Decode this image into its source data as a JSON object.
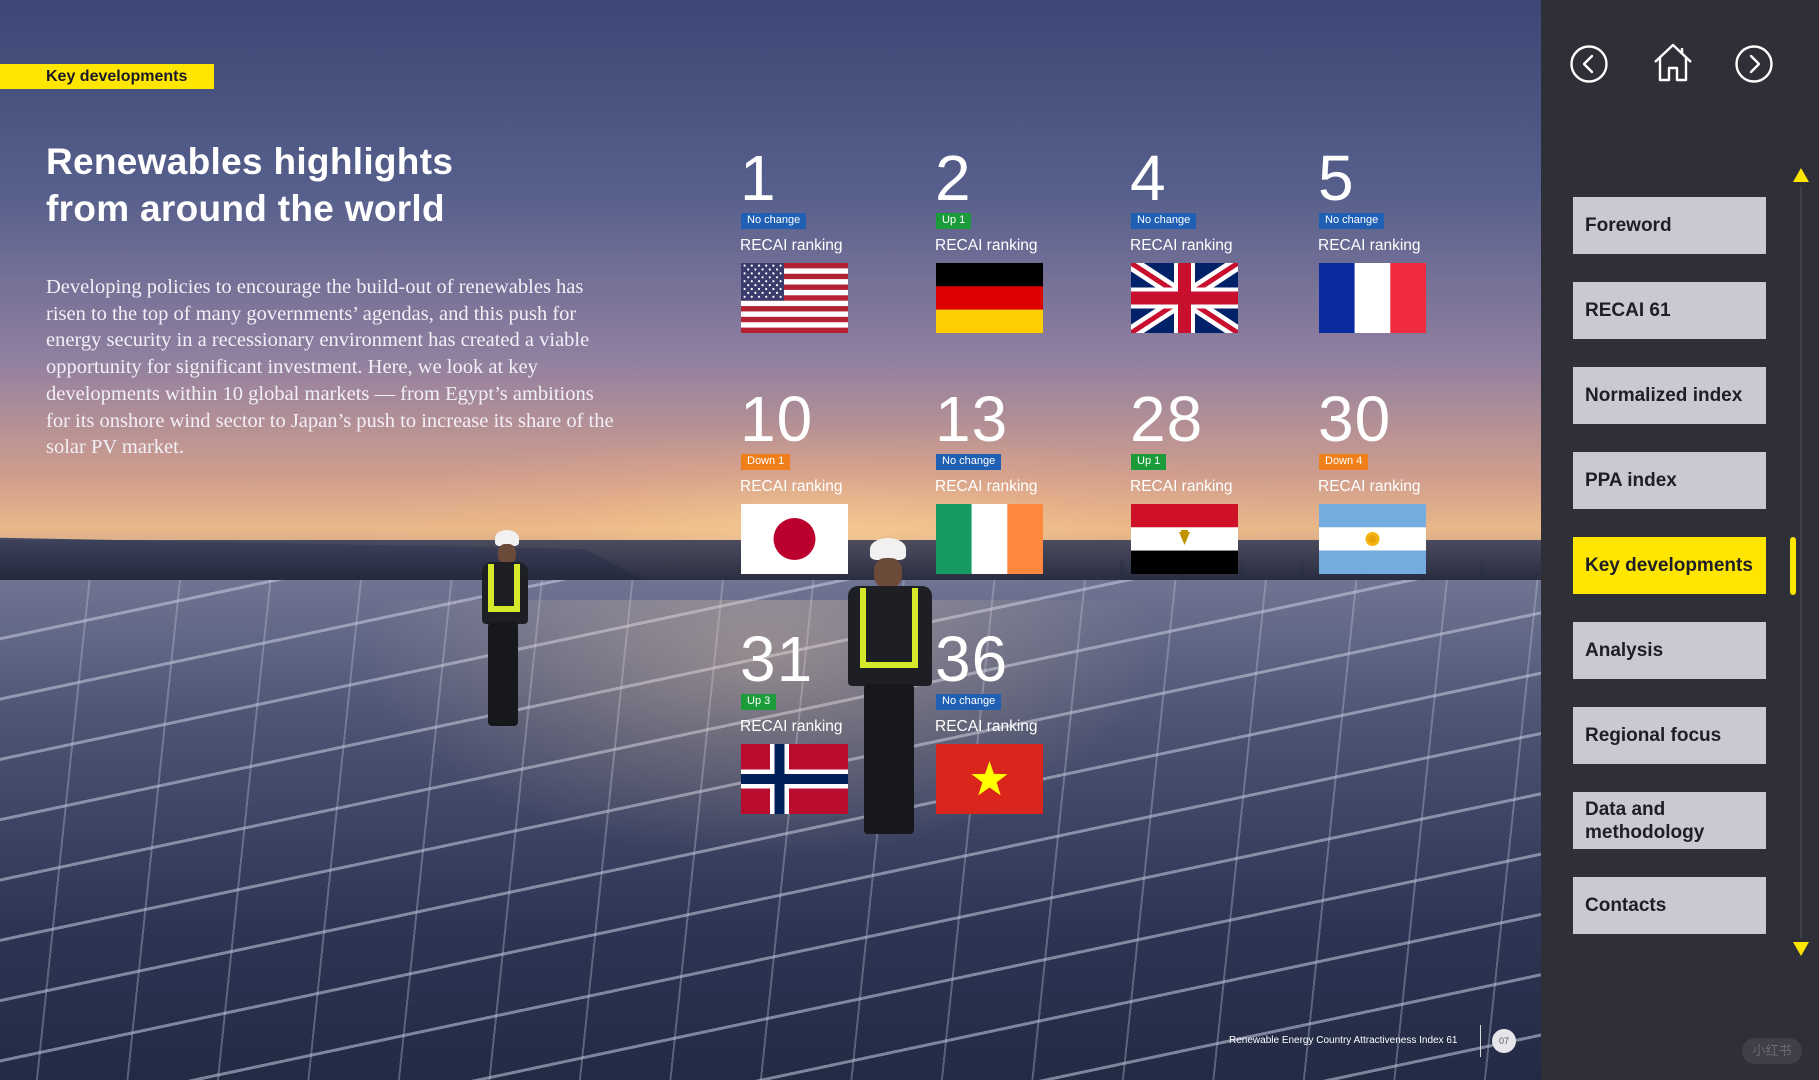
{
  "section_tag": "Key developments",
  "title": {
    "line1": "Renewables highlights",
    "line2": "from around the world"
  },
  "intro": "Developing policies to encourage the build-out of renewables has risen to the top of many governments’ agendas, and this push for energy security in a recessionary environment has created a viable opportunity for significant investment. Here, we look at key developments within 10 global markets — from Egypt’s ambitions for its onshore wind sector to Japan’s push to increase its share of the solar PV market.",
  "colors": {
    "accent_yellow": "#ffe600",
    "badge_no_change": "#1f5fb4",
    "badge_up": "#1c9b3a",
    "badge_down": "#ef7f1a",
    "nav_item_bg": "#c9c9d1",
    "nav_panel_bg": "#2f2f38"
  },
  "countries": [
    {
      "rank": "1",
      "change": "No change",
      "change_type": "no-change",
      "label": "RECAI ranking",
      "flag_icon": "usa-flag-icon"
    },
    {
      "rank": "2",
      "change": "Up 1",
      "change_type": "up",
      "label": "RECAI ranking",
      "flag_icon": "germany-flag-icon"
    },
    {
      "rank": "4",
      "change": "No change",
      "change_type": "no-change",
      "label": "RECAI ranking",
      "flag_icon": "uk-flag-icon"
    },
    {
      "rank": "5",
      "change": "No change",
      "change_type": "no-change",
      "label": "RECAI ranking",
      "flag_icon": "france-flag-icon"
    },
    {
      "rank": "10",
      "change": "Down 1",
      "change_type": "down",
      "label": "RECAI ranking",
      "flag_icon": "japan-flag-icon"
    },
    {
      "rank": "13",
      "change": "No change",
      "change_type": "no-change",
      "label": "RECAI ranking",
      "flag_icon": "ireland-flag-icon"
    },
    {
      "rank": "28",
      "change": "Up 1",
      "change_type": "up",
      "label": "RECAI ranking",
      "flag_icon": "egypt-flag-icon"
    },
    {
      "rank": "30",
      "change": "Down 4",
      "change_type": "down",
      "label": "RECAI ranking",
      "flag_icon": "argentina-flag-icon"
    },
    {
      "rank": "31",
      "change": "Up 3",
      "change_type": "up",
      "label": "RECAI ranking",
      "flag_icon": "norway-flag-icon"
    },
    {
      "rank": "36",
      "change": "No change",
      "change_type": "no-change",
      "label": "RECAI ranking",
      "flag_icon": "vietnam-flag-icon"
    }
  ],
  "nav": {
    "back_icon": "chevron-left-circle-icon",
    "home_icon": "home-icon",
    "forward_icon": "chevron-right-circle-icon",
    "items": [
      {
        "label": "Foreword",
        "active": false
      },
      {
        "label": "RECAI 61",
        "active": false
      },
      {
        "label": "Normalized index",
        "active": false
      },
      {
        "label": "PPA index",
        "active": false
      },
      {
        "label": "Key developments",
        "active": true
      },
      {
        "label": "Analysis",
        "active": false
      },
      {
        "label": "Regional focus",
        "active": false
      },
      {
        "label": "Data and methodology",
        "active": false
      },
      {
        "label": "Contacts",
        "active": false
      }
    ]
  },
  "footer": {
    "report_title": "Renewable Energy Country Attractiveness Index 61",
    "page_number": "07"
  },
  "watermark": "小红书"
}
